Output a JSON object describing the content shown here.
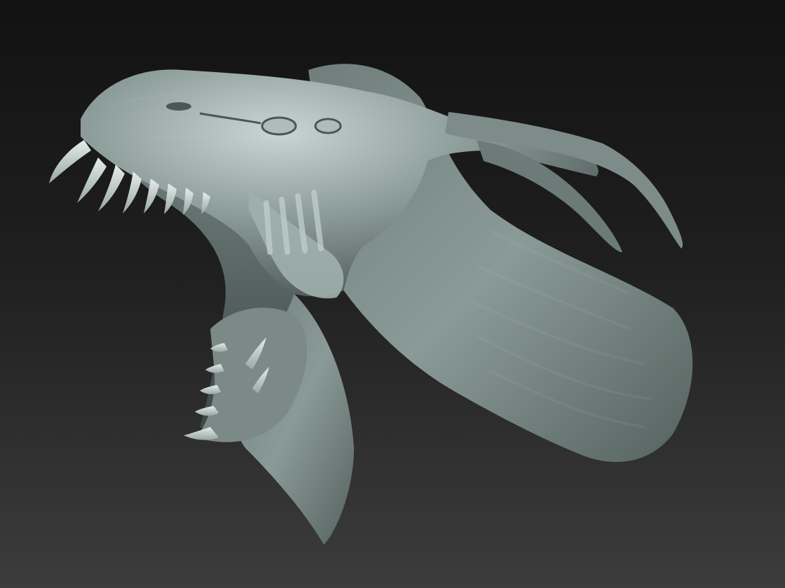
{
  "viewport": {
    "background_top": "#121212",
    "background_bottom": "#3c3c3c"
  },
  "model": {
    "subject": "sculpted-creature-head",
    "material_color": "#8a9a97",
    "material_highlight": "#c9d6d3",
    "material_shadow": "#3f4a48",
    "interior_color": "#556260"
  }
}
